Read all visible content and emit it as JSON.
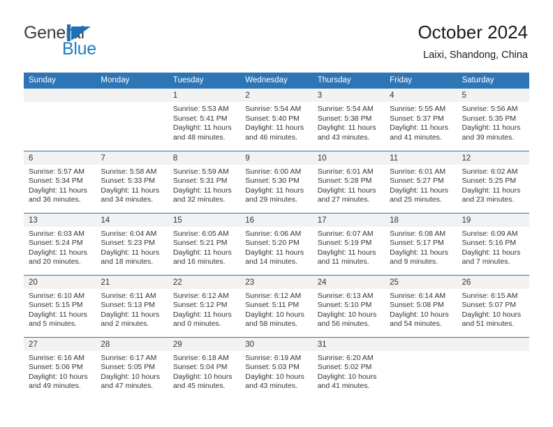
{
  "brand": {
    "word_one": "General",
    "word_two": "Blue",
    "mark": "triangle-flag-icon",
    "color_primary": "#1c6fba",
    "color_text": "#3b3b3b"
  },
  "header": {
    "title": "October 2024",
    "subtitle": "Laixi, Shandong, China"
  },
  "calendar": {
    "accent_color": "#2e75b6",
    "daynum_background": "#f2f2f2",
    "weekday_headers": [
      "Sunday",
      "Monday",
      "Tuesday",
      "Wednesday",
      "Thursday",
      "Friday",
      "Saturday"
    ],
    "labels": {
      "sunrise": "Sunrise:",
      "sunset": "Sunset:",
      "daylight": "Daylight:"
    },
    "weeks": [
      [
        {
          "day": "",
          "blank": true
        },
        {
          "day": "",
          "blank": true
        },
        {
          "day": "1",
          "sunrise": "Sunrise: 5:53 AM",
          "sunset": "Sunset: 5:41 PM",
          "daylight_line1": "Daylight: 11 hours",
          "daylight_line2": "and 48 minutes."
        },
        {
          "day": "2",
          "sunrise": "Sunrise: 5:54 AM",
          "sunset": "Sunset: 5:40 PM",
          "daylight_line1": "Daylight: 11 hours",
          "daylight_line2": "and 46 minutes."
        },
        {
          "day": "3",
          "sunrise": "Sunrise: 5:54 AM",
          "sunset": "Sunset: 5:38 PM",
          "daylight_line1": "Daylight: 11 hours",
          "daylight_line2": "and 43 minutes."
        },
        {
          "day": "4",
          "sunrise": "Sunrise: 5:55 AM",
          "sunset": "Sunset: 5:37 PM",
          "daylight_line1": "Daylight: 11 hours",
          "daylight_line2": "and 41 minutes."
        },
        {
          "day": "5",
          "sunrise": "Sunrise: 5:56 AM",
          "sunset": "Sunset: 5:35 PM",
          "daylight_line1": "Daylight: 11 hours",
          "daylight_line2": "and 39 minutes."
        }
      ],
      [
        {
          "day": "6",
          "sunrise": "Sunrise: 5:57 AM",
          "sunset": "Sunset: 5:34 PM",
          "daylight_line1": "Daylight: 11 hours",
          "daylight_line2": "and 36 minutes."
        },
        {
          "day": "7",
          "sunrise": "Sunrise: 5:58 AM",
          "sunset": "Sunset: 5:33 PM",
          "daylight_line1": "Daylight: 11 hours",
          "daylight_line2": "and 34 minutes."
        },
        {
          "day": "8",
          "sunrise": "Sunrise: 5:59 AM",
          "sunset": "Sunset: 5:31 PM",
          "daylight_line1": "Daylight: 11 hours",
          "daylight_line2": "and 32 minutes."
        },
        {
          "day": "9",
          "sunrise": "Sunrise: 6:00 AM",
          "sunset": "Sunset: 5:30 PM",
          "daylight_line1": "Daylight: 11 hours",
          "daylight_line2": "and 29 minutes."
        },
        {
          "day": "10",
          "sunrise": "Sunrise: 6:01 AM",
          "sunset": "Sunset: 5:28 PM",
          "daylight_line1": "Daylight: 11 hours",
          "daylight_line2": "and 27 minutes."
        },
        {
          "day": "11",
          "sunrise": "Sunrise: 6:01 AM",
          "sunset": "Sunset: 5:27 PM",
          "daylight_line1": "Daylight: 11 hours",
          "daylight_line2": "and 25 minutes."
        },
        {
          "day": "12",
          "sunrise": "Sunrise: 6:02 AM",
          "sunset": "Sunset: 5:25 PM",
          "daylight_line1": "Daylight: 11 hours",
          "daylight_line2": "and 23 minutes."
        }
      ],
      [
        {
          "day": "13",
          "sunrise": "Sunrise: 6:03 AM",
          "sunset": "Sunset: 5:24 PM",
          "daylight_line1": "Daylight: 11 hours",
          "daylight_line2": "and 20 minutes."
        },
        {
          "day": "14",
          "sunrise": "Sunrise: 6:04 AM",
          "sunset": "Sunset: 5:23 PM",
          "daylight_line1": "Daylight: 11 hours",
          "daylight_line2": "and 18 minutes."
        },
        {
          "day": "15",
          "sunrise": "Sunrise: 6:05 AM",
          "sunset": "Sunset: 5:21 PM",
          "daylight_line1": "Daylight: 11 hours",
          "daylight_line2": "and 16 minutes."
        },
        {
          "day": "16",
          "sunrise": "Sunrise: 6:06 AM",
          "sunset": "Sunset: 5:20 PM",
          "daylight_line1": "Daylight: 11 hours",
          "daylight_line2": "and 14 minutes."
        },
        {
          "day": "17",
          "sunrise": "Sunrise: 6:07 AM",
          "sunset": "Sunset: 5:19 PM",
          "daylight_line1": "Daylight: 11 hours",
          "daylight_line2": "and 11 minutes."
        },
        {
          "day": "18",
          "sunrise": "Sunrise: 6:08 AM",
          "sunset": "Sunset: 5:17 PM",
          "daylight_line1": "Daylight: 11 hours",
          "daylight_line2": "and 9 minutes."
        },
        {
          "day": "19",
          "sunrise": "Sunrise: 6:09 AM",
          "sunset": "Sunset: 5:16 PM",
          "daylight_line1": "Daylight: 11 hours",
          "daylight_line2": "and 7 minutes."
        }
      ],
      [
        {
          "day": "20",
          "sunrise": "Sunrise: 6:10 AM",
          "sunset": "Sunset: 5:15 PM",
          "daylight_line1": "Daylight: 11 hours",
          "daylight_line2": "and 5 minutes."
        },
        {
          "day": "21",
          "sunrise": "Sunrise: 6:11 AM",
          "sunset": "Sunset: 5:13 PM",
          "daylight_line1": "Daylight: 11 hours",
          "daylight_line2": "and 2 minutes."
        },
        {
          "day": "22",
          "sunrise": "Sunrise: 6:12 AM",
          "sunset": "Sunset: 5:12 PM",
          "daylight_line1": "Daylight: 11 hours",
          "daylight_line2": "and 0 minutes."
        },
        {
          "day": "23",
          "sunrise": "Sunrise: 6:12 AM",
          "sunset": "Sunset: 5:11 PM",
          "daylight_line1": "Daylight: 10 hours",
          "daylight_line2": "and 58 minutes."
        },
        {
          "day": "24",
          "sunrise": "Sunrise: 6:13 AM",
          "sunset": "Sunset: 5:10 PM",
          "daylight_line1": "Daylight: 10 hours",
          "daylight_line2": "and 56 minutes."
        },
        {
          "day": "25",
          "sunrise": "Sunrise: 6:14 AM",
          "sunset": "Sunset: 5:08 PM",
          "daylight_line1": "Daylight: 10 hours",
          "daylight_line2": "and 54 minutes."
        },
        {
          "day": "26",
          "sunrise": "Sunrise: 6:15 AM",
          "sunset": "Sunset: 5:07 PM",
          "daylight_line1": "Daylight: 10 hours",
          "daylight_line2": "and 51 minutes."
        }
      ],
      [
        {
          "day": "27",
          "sunrise": "Sunrise: 6:16 AM",
          "sunset": "Sunset: 5:06 PM",
          "daylight_line1": "Daylight: 10 hours",
          "daylight_line2": "and 49 minutes."
        },
        {
          "day": "28",
          "sunrise": "Sunrise: 6:17 AM",
          "sunset": "Sunset: 5:05 PM",
          "daylight_line1": "Daylight: 10 hours",
          "daylight_line2": "and 47 minutes."
        },
        {
          "day": "29",
          "sunrise": "Sunrise: 6:18 AM",
          "sunset": "Sunset: 5:04 PM",
          "daylight_line1": "Daylight: 10 hours",
          "daylight_line2": "and 45 minutes."
        },
        {
          "day": "30",
          "sunrise": "Sunrise: 6:19 AM",
          "sunset": "Sunset: 5:03 PM",
          "daylight_line1": "Daylight: 10 hours",
          "daylight_line2": "and 43 minutes."
        },
        {
          "day": "31",
          "sunrise": "Sunrise: 6:20 AM",
          "sunset": "Sunset: 5:02 PM",
          "daylight_line1": "Daylight: 10 hours",
          "daylight_line2": "and 41 minutes."
        },
        {
          "day": "",
          "blank": true
        },
        {
          "day": "",
          "blank": true
        }
      ]
    ]
  }
}
